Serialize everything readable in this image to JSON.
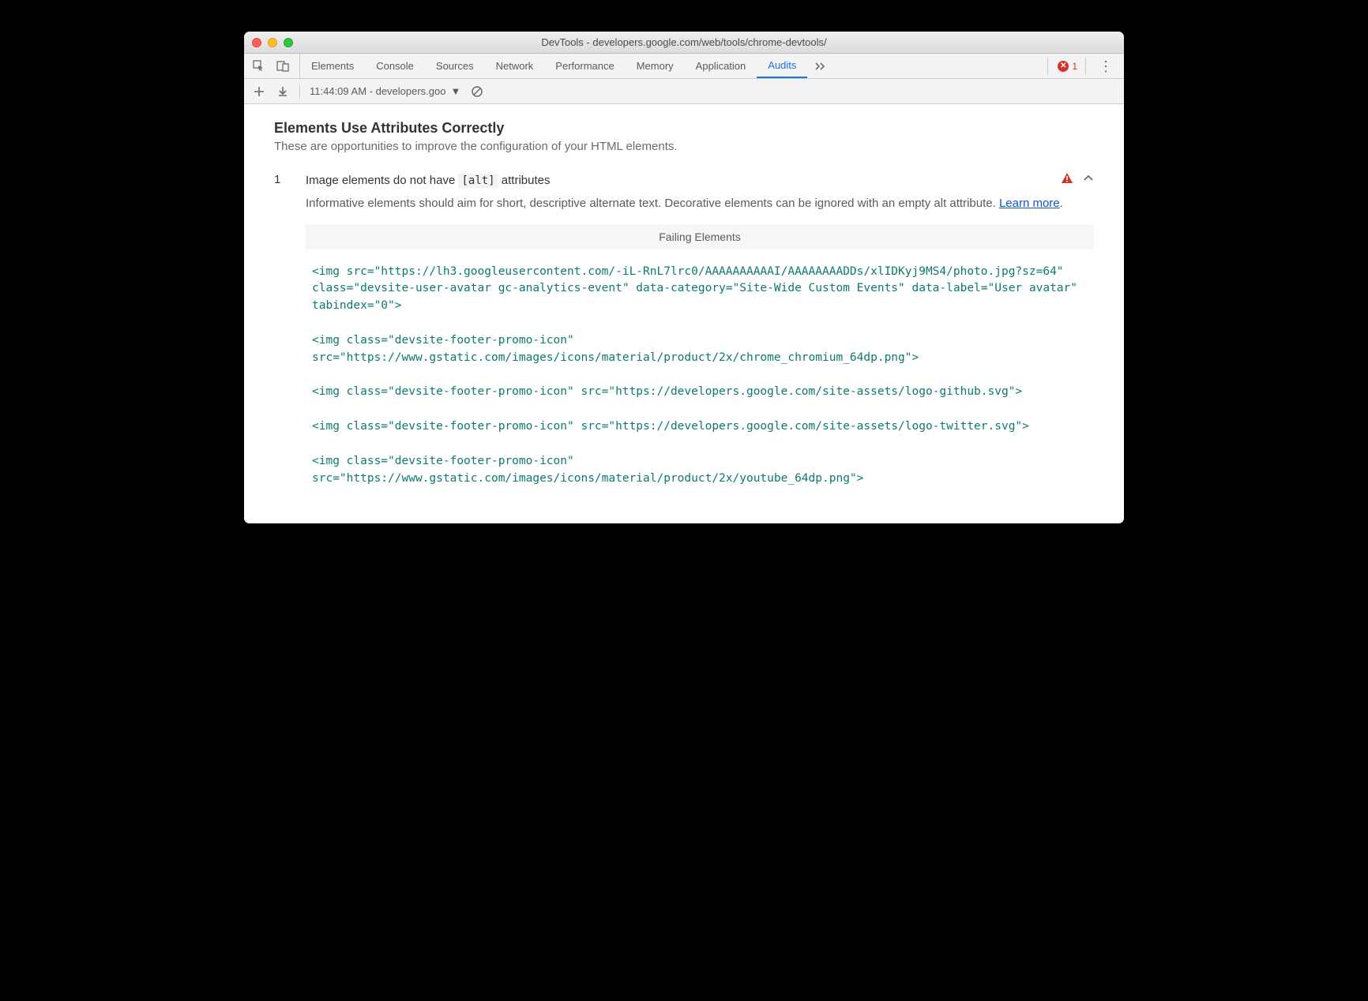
{
  "window": {
    "title": "DevTools - developers.google.com/web/tools/chrome-devtools/"
  },
  "tabs": {
    "elements": "Elements",
    "console": "Console",
    "sources": "Sources",
    "network": "Network",
    "performance": "Performance",
    "memory": "Memory",
    "application": "Application",
    "audits": "Audits"
  },
  "error_count": "1",
  "toolbar": {
    "audit_label": "11:44:09 AM - developers.goo"
  },
  "section": {
    "title": "Elements Use Attributes Correctly",
    "subtitle": "These are opportunities to improve the configuration of your HTML elements."
  },
  "audit": {
    "num": "1",
    "title_pre": "Image elements do not have ",
    "title_code": "[alt]",
    "title_post": " attributes",
    "desc": "Informative elements should aim for short, descriptive alternate text. Decorative elements can be ignored with an empty alt attribute. ",
    "learn_more": "Learn more",
    "failing_header": "Failing Elements",
    "items": [
      "<img src=\"https://lh3.googleusercontent.com/-iL-RnL7lrc0/AAAAAAAAAAI/AAAAAAAADDs/xlIDKyj9MS4/photo.jpg?sz=64\" class=\"devsite-user-avatar gc-analytics-event\" data-category=\"Site-Wide Custom Events\" data-label=\"User avatar\" tabindex=\"0\">",
      "<img class=\"devsite-footer-promo-icon\" src=\"https://www.gstatic.com/images/icons/material/product/2x/chrome_chromium_64dp.png\">",
      "<img class=\"devsite-footer-promo-icon\" src=\"https://developers.google.com/site-assets/logo-github.svg\">",
      "<img class=\"devsite-footer-promo-icon\" src=\"https://developers.google.com/site-assets/logo-twitter.svg\">",
      "<img class=\"devsite-footer-promo-icon\" src=\"https://www.gstatic.com/images/icons/material/product/2x/youtube_64dp.png\">"
    ]
  }
}
